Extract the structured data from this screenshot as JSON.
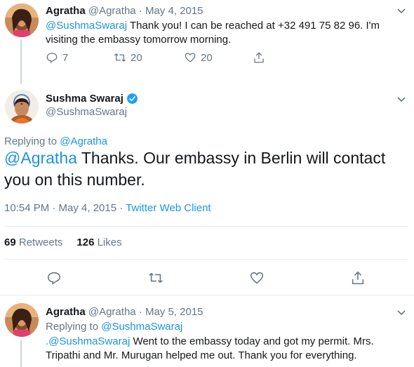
{
  "tweet_parent": {
    "name": "Agratha",
    "handle": "@Agratha",
    "date": "· May 4, 2015",
    "mention": "@SushmaSwaraj",
    "text": " Thank you! I can be reached at +32 491 75 82 96. I'm visiting the embassy tomorrow morning.",
    "replies": "7",
    "retweets": "20",
    "likes": "20"
  },
  "tweet_main": {
    "name": "Sushma Swaraj",
    "handle": "@SushmaSwaraj",
    "replying_prefix": "Replying to ",
    "replying_to": "@Agratha",
    "mention": "@Agratha",
    "text": " Thanks. Our embassy in Berlin will contact you on this number.",
    "time": "10:54 PM · May 4, 2015 · ",
    "client": "Twitter Web Client",
    "retweet_count": "69",
    "retweet_label": " Retweets",
    "like_count": "126",
    "like_label": " Likes"
  },
  "tweet_reply": {
    "name": "Agratha",
    "handle": "@Agratha",
    "date": "· May 5, 2015",
    "replying_prefix": "Replying to ",
    "replying_to": "@SushmaSwaraj",
    "mention": ".@SushmaSwaraj",
    "text": " Went to the embassy today and got my permit. Mrs. Tripathi and Mr. Murugan helped me out. Thank you for everything."
  },
  "colors": {
    "link": "#1b95e0",
    "muted": "#657786",
    "verified": "#1da1f2"
  },
  "icons": [
    "caret-down-icon",
    "reply-icon",
    "retweet-icon",
    "like-icon",
    "share-icon",
    "verified-badge-icon"
  ]
}
